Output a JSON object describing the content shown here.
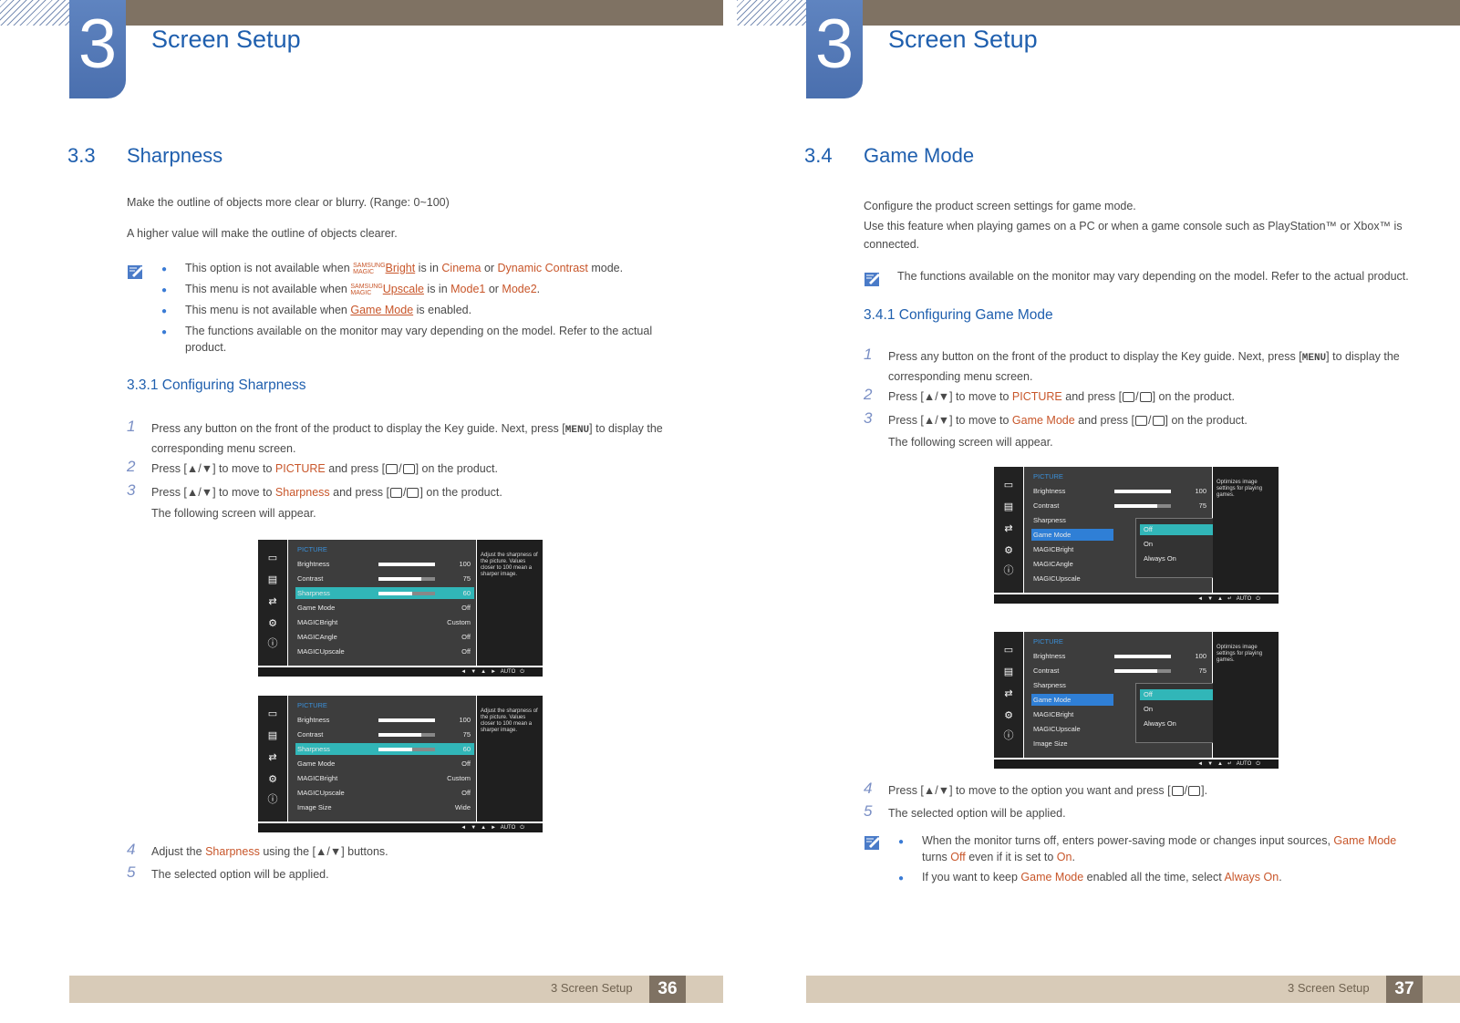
{
  "left": {
    "chapter_number": "3",
    "chapter_title": "Screen Setup",
    "section_number": "3.3",
    "section_title": "Sharpness",
    "intro1": "Make the outline of objects more clear or blurry. (Range: 0~100)",
    "intro2": "A higher value will make the outline of objects clearer.",
    "notes": [
      {
        "pre": "This option is not available when ",
        "magic": "SAMSUNG MAGIC",
        "link": "Bright",
        "mid": " is in ",
        "h1": "Cinema",
        "or": " or ",
        "h2": "Dynamic Contrast",
        "post": " mode."
      },
      {
        "pre": "This menu is not available when ",
        "magic": "SAMSUNG MAGIC",
        "link": "Upscale",
        "mid": " is in ",
        "h1": "Mode1",
        "or": " or ",
        "h2": "Mode2",
        "post": "."
      },
      {
        "pre": "This menu is not available when ",
        "link": "Game Mode",
        "post": " is enabled."
      },
      {
        "text": "The functions available on the monitor may vary depending on the model. Refer to the actual product."
      }
    ],
    "subsection": "3.3.1    Configuring Sharpness",
    "steps": {
      "s1_num": "1",
      "s1_a": "Press any button on the front of the product to display the Key guide. Next, press [",
      "s1_key": "MENU",
      "s1_b": "] to display the corresponding menu screen.",
      "s2_num": "2",
      "s2_a": "Press [▲/▼] to move to ",
      "s2_h": "PICTURE",
      "s2_b": " and press [",
      "s2_c": "] on the product.",
      "s3_num": "3",
      "s3_a": "Press [▲/▼] to move to ",
      "s3_h": "Sharpness",
      "s3_b": " and press [",
      "s3_c": "] on the product.",
      "following": "The following screen will appear.",
      "s4_num": "4",
      "s4_a": "Adjust the ",
      "s4_h": "Sharpness",
      "s4_b": " using the [▲/▼] buttons.",
      "s5_num": "5",
      "s5_a": "The selected option will be applied."
    },
    "osd1": {
      "title": "PICTURE",
      "rows": [
        {
          "label": "Brightness",
          "value": "100",
          "bar": 100
        },
        {
          "label": "Contrast",
          "value": "75",
          "bar": 75
        },
        {
          "label": "Sharpness",
          "value": "60",
          "bar": 60
        },
        {
          "label": "Game Mode",
          "value": "Off"
        },
        {
          "label": "MAGICBright",
          "value": "Custom"
        },
        {
          "label": "MAGICAngle",
          "value": "Off"
        },
        {
          "label": "MAGICUpscale",
          "value": "Off"
        }
      ],
      "help": "Adjust the sharpness of the picture. Values closer to 100 mean a sharper image.",
      "auto": "AUTO"
    },
    "osd2": {
      "title": "PICTURE",
      "rows": [
        {
          "label": "Brightness",
          "value": "100",
          "bar": 100
        },
        {
          "label": "Contrast",
          "value": "75",
          "bar": 75
        },
        {
          "label": "Sharpness",
          "value": "60",
          "bar": 60
        },
        {
          "label": "Game Mode",
          "value": "Off"
        },
        {
          "label": "MAGICBright",
          "value": "Custom"
        },
        {
          "label": "MAGICUpscale",
          "value": "Off"
        },
        {
          "label": "Image Size",
          "value": "Wide"
        }
      ],
      "help": "Adjust the sharpness of the picture. Values closer to 100 mean a sharper image.",
      "auto": "AUTO"
    },
    "footer_text": "3 Screen Setup",
    "page_number": "36"
  },
  "right": {
    "chapter_number": "3",
    "chapter_title": "Screen Setup",
    "section_number": "3.4",
    "section_title": "Game Mode",
    "intro1": "Configure the product screen settings for game mode.",
    "intro2": "Use this feature when playing games on a PC or when a game console such as PlayStation™ or Xbox™ is connected.",
    "note1": "The functions available on the monitor may vary depending on the model. Refer to the actual product.",
    "subsection": "3.4.1    Configuring Game Mode",
    "steps": {
      "s1_num": "1",
      "s1_a": "Press any button on the front of the product to display the Key guide. Next, press [",
      "s1_key": "MENU",
      "s1_b": "] to display the corresponding menu screen.",
      "s2_num": "2",
      "s2_a": "Press [▲/▼] to move to ",
      "s2_h": "PICTURE",
      "s2_b": " and press [",
      "s2_c": "] on the product.",
      "s3_num": "3",
      "s3_a": "Press [▲/▼] to move to ",
      "s3_h": "Game Mode",
      "s3_b": " and press [",
      "s3_c": "] on the product.",
      "following": "The following screen will appear.",
      "s4_num": "4",
      "s4_a": "Press [▲/▼] to move to the option you want and press [",
      "s4_b": "].",
      "s5_num": "5",
      "s5_a": "The selected option will be applied."
    },
    "osd1": {
      "title": "PICTURE",
      "rows": [
        {
          "label": "Brightness",
          "value": "100",
          "bar": 100
        },
        {
          "label": "Contrast",
          "value": "75",
          "bar": 75
        },
        {
          "label": "Sharpness",
          "value": ""
        },
        {
          "label": "Game Mode",
          "value": ""
        },
        {
          "label": "MAGICBright",
          "value": ""
        },
        {
          "label": "MAGICAngle",
          "value": ""
        },
        {
          "label": "MAGICUpscale",
          "value": ""
        }
      ],
      "options": [
        "Off",
        "On",
        "Always On"
      ],
      "help": "Optimizes image settings for playing games.",
      "auto": "AUTO"
    },
    "osd2": {
      "title": "PICTURE",
      "rows": [
        {
          "label": "Brightness",
          "value": "100",
          "bar": 100
        },
        {
          "label": "Contrast",
          "value": "75",
          "bar": 75
        },
        {
          "label": "Sharpness",
          "value": ""
        },
        {
          "label": "Game Mode",
          "value": ""
        },
        {
          "label": "MAGICBright",
          "value": ""
        },
        {
          "label": "MAGICUpscale",
          "value": ""
        },
        {
          "label": "Image Size",
          "value": ""
        }
      ],
      "options": [
        "Off",
        "On",
        "Always On"
      ],
      "help": "Optimizes image settings for playing games.",
      "auto": "AUTO"
    },
    "note2_a": "When the monitor turns off, enters power-saving mode or changes input sources, ",
    "note2_h1": "Game Mode",
    "note2_b": " turns ",
    "note2_h2": "Off",
    "note2_c": " even if it is set to ",
    "note2_h3": "On",
    "note2_d": ".",
    "note3_a": "If you want to keep ",
    "note3_h1": "Game Mode",
    "note3_b": " enabled all the time, select ",
    "note3_h2": "Always On",
    "note3_c": ".",
    "footer_text": "3 Screen Setup",
    "page_number": "37"
  }
}
